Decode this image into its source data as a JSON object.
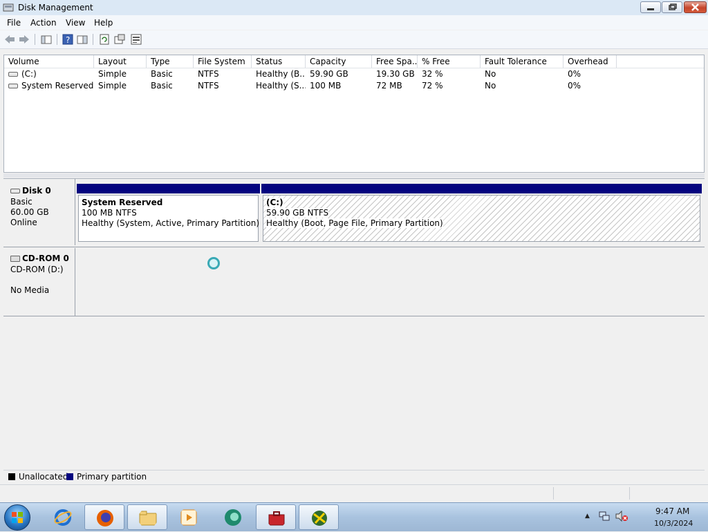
{
  "window": {
    "title": "Disk Management"
  },
  "menu": [
    "File",
    "Action",
    "View",
    "Help"
  ],
  "volume_list": {
    "columns": [
      "Volume",
      "Layout",
      "Type",
      "File System",
      "Status",
      "Capacity",
      "Free Spa...",
      "% Free",
      "Fault Tolerance",
      "Overhead"
    ],
    "rows": [
      [
        "(C:)",
        "Simple",
        "Basic",
        "NTFS",
        "Healthy (B...",
        "59.90 GB",
        "19.30 GB",
        "32 %",
        "No",
        "0%"
      ],
      [
        "System Reserved",
        "Simple",
        "Basic",
        "NTFS",
        "Healthy (S...",
        "100 MB",
        "72 MB",
        "72 %",
        "No",
        "0%"
      ]
    ]
  },
  "disks": [
    {
      "name": "Disk 0",
      "type": "Basic",
      "size": "60.00 GB",
      "status": "Online",
      "partitions": [
        {
          "name": "System Reserved",
          "size_fs": "100 MB NTFS",
          "status": "Healthy (System, Active, Primary Partition)"
        },
        {
          "name": "(C:)",
          "size_fs": "59.90 GB NTFS",
          "status": "Healthy (Boot, Page File, Primary Partition)"
        }
      ]
    },
    {
      "name": "CD-ROM 0",
      "type": "CD-ROM (D:)",
      "size": "",
      "status": "No Media"
    }
  ],
  "legend": [
    {
      "label": "Unallocated",
      "color": "#000000"
    },
    {
      "label": "Primary partition",
      "color": "#04047f"
    }
  ],
  "taskbar": {
    "apps": [
      "internet-explorer",
      "firefox",
      "windows-explorer",
      "media-player",
      "app-green-circle",
      "toolbox",
      "app-globe"
    ],
    "clock": {
      "time": "9:47 AM",
      "date": "10/3/2024"
    }
  }
}
